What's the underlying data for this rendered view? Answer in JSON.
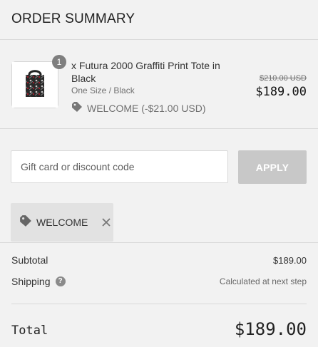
{
  "header": {
    "title": "ORDER SUMMARY"
  },
  "item": {
    "quantity": "1",
    "name": "x Futura 2000 Graffiti Print Tote in Black",
    "variant": "One Size / Black",
    "discount_text": "WELCOME (-$21.00 USD)",
    "original_price": "$210.00 USD",
    "price": "$189.00"
  },
  "discount_form": {
    "placeholder": "Gift card or discount code",
    "apply_label": "APPLY"
  },
  "applied_code": {
    "label": "WELCOME"
  },
  "summary": {
    "subtotal_label": "Subtotal",
    "subtotal_value": "$189.00",
    "shipping_label": "Shipping",
    "shipping_value": "Calculated at next step",
    "total_label": "Total",
    "total_value": "$189.00"
  },
  "icons": {
    "tag": "tag-icon",
    "close": "close-icon",
    "help": "help-icon"
  }
}
